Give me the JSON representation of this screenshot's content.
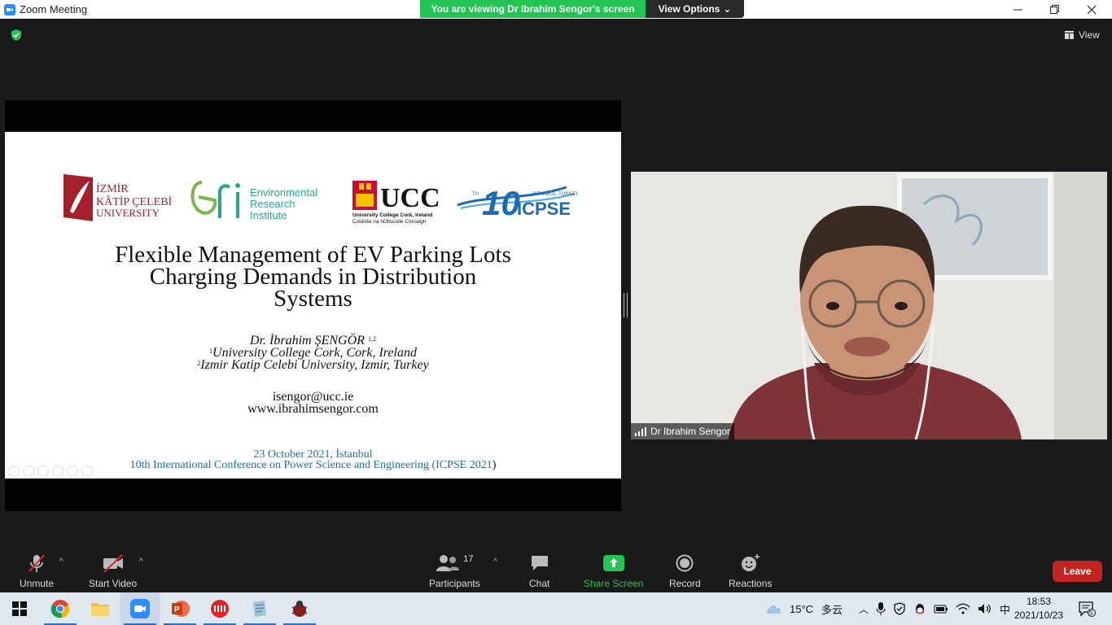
{
  "window": {
    "title": "Zoom Meeting",
    "controls": [
      "minimize",
      "restore",
      "close"
    ]
  },
  "banner": {
    "viewing_text": "You are viewing Dr Ibrahim Sengor's screen",
    "view_options_label": "View Options"
  },
  "top_right": {
    "view_label": "View"
  },
  "slide": {
    "logos": [
      {
        "name": "izmir-katip-celebi-university-logo",
        "lines": [
          "İZMİR",
          "KÂTİP ÇELEBİ",
          "UNIVERSITY"
        ]
      },
      {
        "name": "environmental-research-institute-logo",
        "lines": [
          "Environmental",
          "Research",
          "Institute"
        ]
      },
      {
        "name": "ucc-logo",
        "lines": [
          "UCC",
          "University College Cork, Ireland",
          "Coláiste na hOllscoile Corcaigh"
        ]
      },
      {
        "name": "icpse-logo",
        "lines": [
          "10",
          "TH",
          "ISTANBUL, TURKEY",
          "ICPSE"
        ]
      }
    ],
    "title_lines": [
      "Flexible Management of EV Parking Lots",
      "Charging Demands in Distribution",
      "Systems"
    ],
    "author": "Dr. İbrahim ŞENGÖR",
    "author_sup": "1,2",
    "affiliation_1_sup": "1",
    "affiliation_1": "University College Cork, Cork, Ireland",
    "affiliation_2_sup": "2",
    "affiliation_2": "Izmir Katip Celebi University, Izmir, Turkey",
    "email": "isengor@ucc.ie",
    "website": "www.ibrahimsengor.com",
    "date": "23 October 2021, İstanbul",
    "conference": "10th International Conference on Power Science and Engineering (ICPSE 2021",
    "conference_close": ")"
  },
  "participant_video": {
    "name": "Dr Ibrahim Sengor"
  },
  "toolbar": {
    "unmute": "Unmute",
    "start_video": "Start Video",
    "participants": "Participants",
    "participants_count": "17",
    "chat": "Chat",
    "share_screen": "Share Screen",
    "record": "Record",
    "reactions": "Reactions",
    "leave": "Leave"
  },
  "taskbar": {
    "apps": [
      "start",
      "chrome",
      "file-explorer",
      "zoom",
      "powerpoint",
      "app-red",
      "app-notes",
      "app-bug"
    ],
    "weather_temp": "15°C",
    "weather_text": "多云",
    "ime": "中",
    "time": "18:53",
    "date": "2021/10/23",
    "notification_count": "5"
  },
  "colors": {
    "banner_green": "#23c552",
    "share_green": "#23c552",
    "leave_red": "#c4241f",
    "conference_blue": "#1f6fb0"
  }
}
